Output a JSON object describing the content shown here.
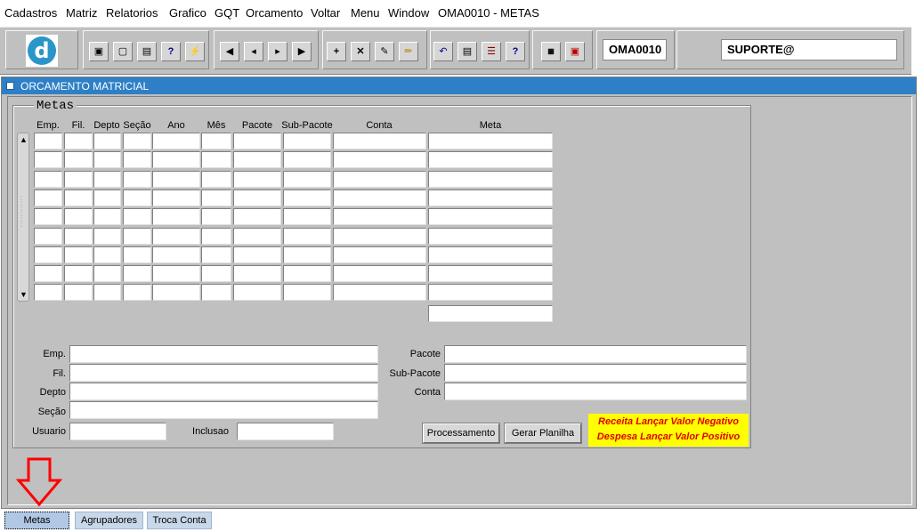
{
  "menu": [
    {
      "label": "Cadastros"
    },
    {
      "label": "Matriz"
    },
    {
      "label": "Relatorios"
    },
    {
      "label": "Grafico"
    },
    {
      "label": "GQT"
    },
    {
      "label": "Orcamento"
    },
    {
      "label": "Voltar"
    },
    {
      "label": "Menu"
    },
    {
      "label": "Window"
    },
    {
      "label": "OMA0010 - METAS"
    }
  ],
  "toolbar": {
    "form_code": "OMA0010",
    "user": "SUPORTE@",
    "icons": [
      "save-icon",
      "screen-icon",
      "print-icon",
      "query-icon",
      "execute-query-icon",
      "first-record-icon",
      "prev-record-icon",
      "next-record-icon",
      "last-record-icon",
      "insert-record-icon",
      "delete-record-icon",
      "edit-icon",
      "clear-icon",
      "undo-icon",
      "clipboard-icon",
      "list-icon",
      "help-icon",
      "menu-icon",
      "exit-icon"
    ]
  },
  "window": {
    "title": "ORCAMENTO MATRICIAL"
  },
  "frame": {
    "label": "Metas"
  },
  "grid": {
    "headers": [
      "Emp.",
      "Fil.",
      "Depto",
      "Seção",
      "Ano",
      "Mês",
      "Pacote",
      "Sub-Pacote",
      "Conta",
      "Meta"
    ],
    "rows": 9
  },
  "detail": {
    "emp_label": "Emp.",
    "fil_label": "Fil.",
    "depto_label": "Depto",
    "secao_label": "Seção",
    "usuario_label": "Usuario",
    "inclusao_label": "Inclusao",
    "pacote_label": "Pacote",
    "subpacote_label": "Sub-Pacote",
    "conta_label": "Conta"
  },
  "buttons": {
    "processamento": "Processamento",
    "gerar_planilha": "Gerar Planilha"
  },
  "notice": {
    "line1": "Receita Lançar Valor Negativo",
    "line2": "Despesa Lançar Valor Positivo"
  },
  "tabs": [
    {
      "label": "Metas",
      "active": true
    },
    {
      "label": "Agrupadores",
      "active": false
    },
    {
      "label": "Troca Conta",
      "active": false
    }
  ],
  "colors": {
    "title_bar": "#2e7fc6",
    "notice_bg": "#ffff00",
    "notice_text": "#e00000",
    "annotation_arrow": "#ff0000"
  }
}
